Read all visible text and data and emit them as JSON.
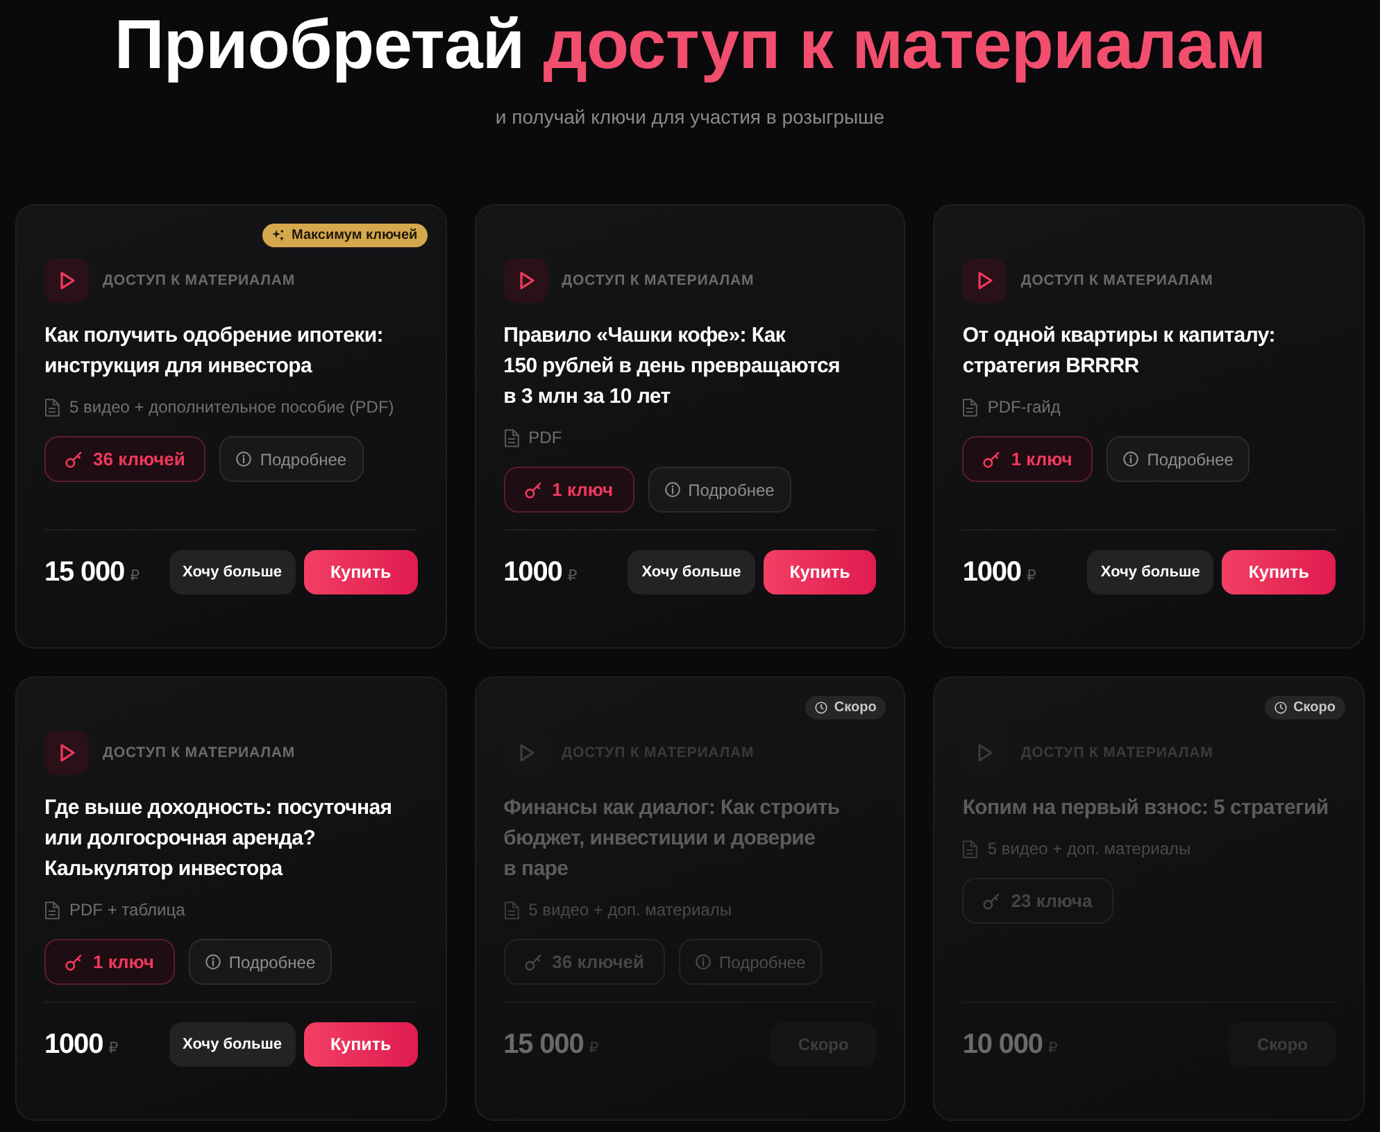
{
  "header": {
    "title": "Приобретай",
    "title_highlight": "доступ к материалам",
    "subtitle": "и получай ключи для участия в розыгрыше"
  },
  "cards": [
    {
      "disabled": false,
      "badge": {
        "kind": "max_keys",
        "text": "Максимум ключей"
      },
      "category": "ДОСТУП К МАТЕРИАЛАМ",
      "title": "Как получить одобрение ипотеки:\nинструкция для инвестора",
      "meta": "5 видео + дополнительное пособие (PDF)",
      "keys": "36 ключей",
      "details": "Подробнее",
      "price": "15 000",
      "currency": "₽",
      "actions": [
        {
          "kind": "secondary",
          "label": "Хочу больше"
        },
        {
          "kind": "primary",
          "label": "Купить"
        }
      ]
    },
    {
      "disabled": false,
      "category": "ДОСТУП К МАТЕРИАЛАМ",
      "title": "Правило «Чашки кофе»: Как\n150 рублей в день превращаются\nв 3 млн за 10 лет",
      "meta": "PDF",
      "keys": "1 ключ",
      "details": "Подробнее",
      "price": "1000",
      "currency": "₽",
      "actions": [
        {
          "kind": "secondary",
          "label": "Хочу больше"
        },
        {
          "kind": "primary",
          "label": "Купить"
        }
      ]
    },
    {
      "disabled": false,
      "category": "ДОСТУП К МАТЕРИАЛАМ",
      "title": "От одной квартиры к капиталу:\nстратегия BRRRR",
      "meta": "PDF-гайд",
      "keys": "1 ключ",
      "details": "Подробнее",
      "price": "1000",
      "currency": "₽",
      "actions": [
        {
          "kind": "secondary",
          "label": "Хочу больше"
        },
        {
          "kind": "primary",
          "label": "Купить"
        }
      ]
    },
    {
      "disabled": false,
      "category": "ДОСТУП К МАТЕРИАЛАМ",
      "title": "Где выше доходность: посуточная\nили долгосрочная аренда?\nКалькулятор инвестора",
      "meta": "PDF + таблица",
      "keys": "1 ключ",
      "details": "Подробнее",
      "price": "1000",
      "currency": "₽",
      "actions": [
        {
          "kind": "secondary",
          "label": "Хочу больше"
        },
        {
          "kind": "primary",
          "label": "Купить"
        }
      ]
    },
    {
      "disabled": true,
      "badge": {
        "kind": "soon",
        "text": "Скоро"
      },
      "category": "ДОСТУП К МАТЕРИАЛАМ",
      "title": "Финансы как диалог: Как строить\nбюджет, инвестиции и доверие\nв паре",
      "meta": "5 видео + доп. материалы",
      "keys": "36 ключей",
      "details": "Подробнее",
      "price": "15 000",
      "currency": "₽",
      "actions": [
        {
          "kind": "soon",
          "label": "Скоро"
        }
      ]
    },
    {
      "disabled": true,
      "badge": {
        "kind": "soon",
        "text": "Скоро"
      },
      "category": "ДОСТУП К МАТЕРИАЛАМ",
      "title": "Копим на первый взнос: 5 стратегий",
      "meta": "5 видео + доп. материалы",
      "keys": "23 ключа",
      "price": "10 000",
      "currency": "₽",
      "actions": [
        {
          "kind": "soon",
          "label": "Скоро"
        }
      ]
    }
  ]
}
